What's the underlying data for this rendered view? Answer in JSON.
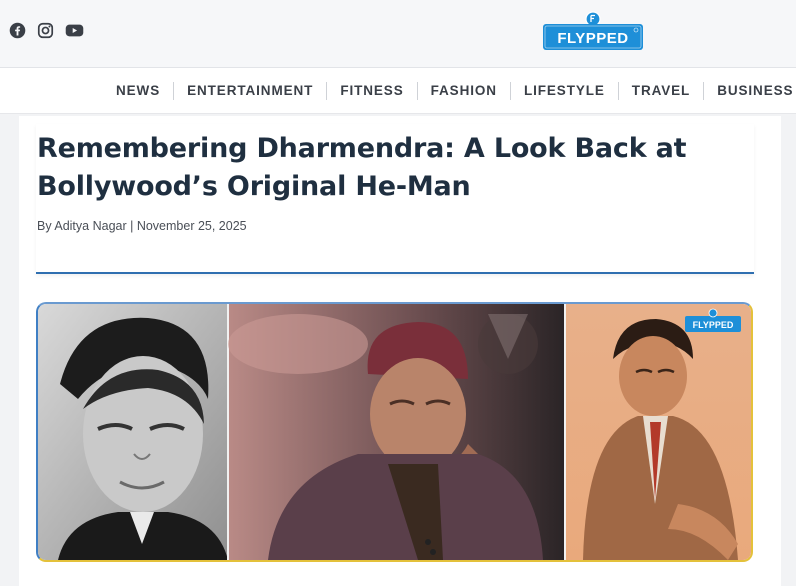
{
  "social": [
    {
      "name": "facebook-icon"
    },
    {
      "name": "instagram-icon"
    },
    {
      "name": "youtube-icon"
    }
  ],
  "brand": {
    "logo_text": "FLYPPED",
    "watermark": "FLYPPED"
  },
  "nav": {
    "items": [
      "NEWS",
      "ENTERTAINMENT",
      "FITNESS",
      "FASHION",
      "LIFESTYLE",
      "TRAVEL",
      "BUSINESS"
    ]
  },
  "article": {
    "title": "Remembering Dharmendra: A Look Back at Bollywood’s Original He-Man",
    "byline": "By Aditya Nagar | November 25, 2025"
  },
  "colors": {
    "brand_blue": "#1e8fd8",
    "accent_rule": "#2f6fb0",
    "title": "#1f2f40"
  }
}
